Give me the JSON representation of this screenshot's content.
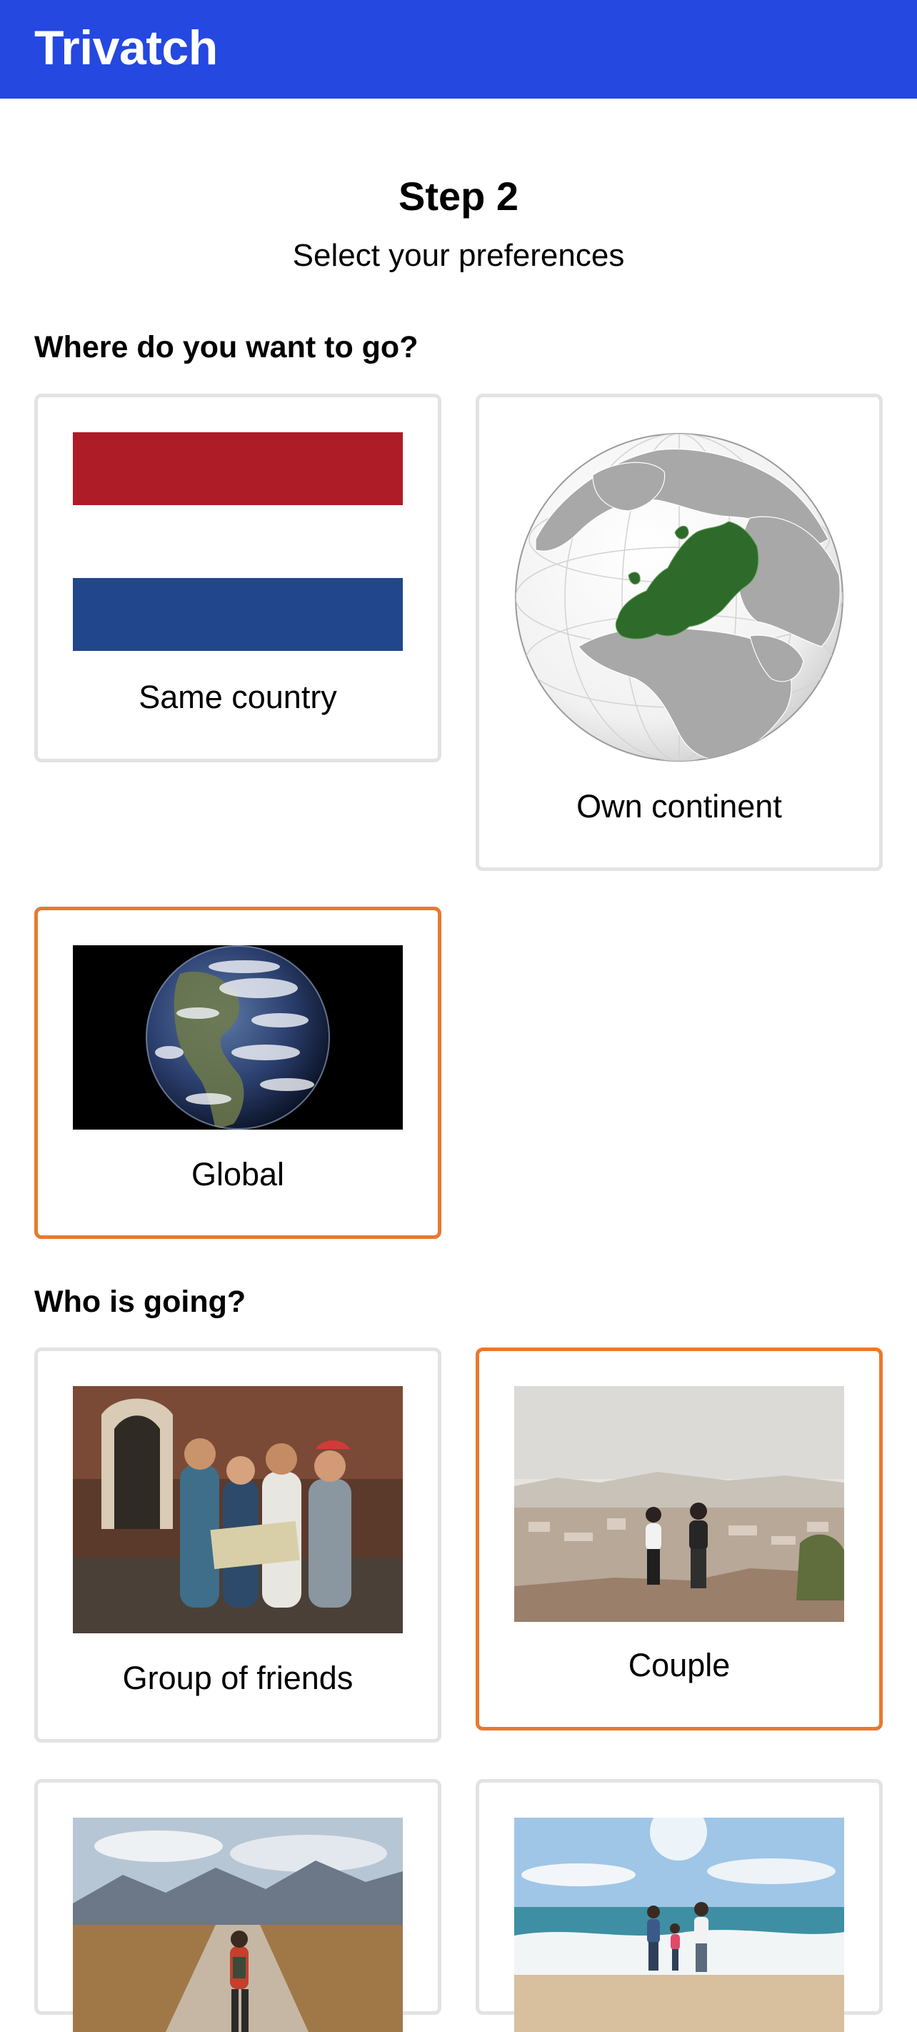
{
  "app": {
    "title": "Trivatch"
  },
  "step": {
    "title": "Step 2",
    "subtitle": "Select your preferences"
  },
  "destination": {
    "heading": "Where do you want to go?",
    "options": [
      {
        "label": "Same country",
        "selected": false,
        "image": "netherlands-flag"
      },
      {
        "label": "Own continent",
        "selected": false,
        "image": "europe-globe"
      },
      {
        "label": "Global",
        "selected": true,
        "image": "earth-from-space"
      }
    ]
  },
  "companions": {
    "heading": "Who is going?",
    "options": [
      {
        "label": "Group of friends",
        "selected": false,
        "image": "friends-with-map-photo"
      },
      {
        "label": "Couple",
        "selected": true,
        "image": "couple-overlooking-city-photo"
      },
      {
        "label": "",
        "selected": false,
        "image": "solo-hiker-road-photo"
      },
      {
        "label": "",
        "selected": false,
        "image": "family-on-beach-photo"
      }
    ]
  },
  "colors": {
    "header": "#2448e0",
    "selected_border": "#e8792f",
    "card_border": "#e3e3e3",
    "flag_red": "#ae1c28",
    "flag_blue": "#21468b",
    "europe_green": "#2e6b2a"
  }
}
